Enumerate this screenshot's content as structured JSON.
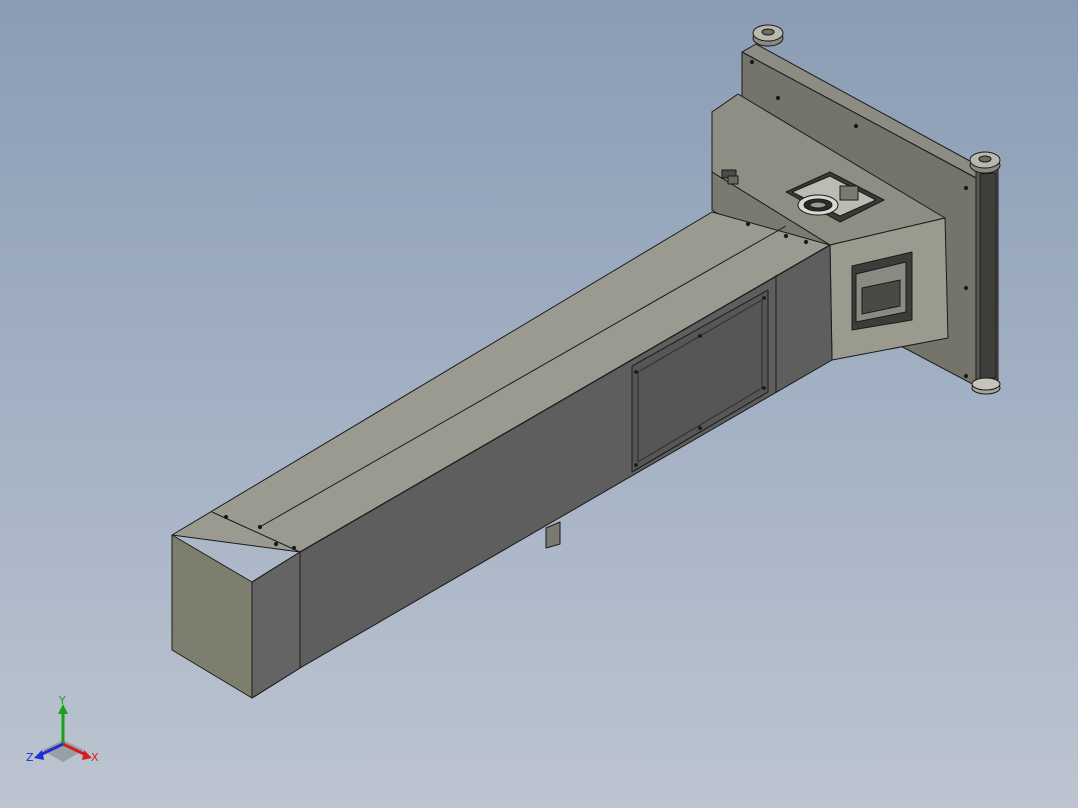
{
  "triad": {
    "x_label": "X",
    "y_label": "Y",
    "z_label": "Z",
    "x_color": "#d42020",
    "y_color": "#18a018",
    "z_color": "#2030d0"
  },
  "colors": {
    "beam_top": "#9a9a90",
    "beam_front": "#5e5e5e",
    "beam_end": "#7e7e6e",
    "housing": "#8a8a80",
    "plate": "#74746a",
    "edge": "#1a1a1a"
  }
}
